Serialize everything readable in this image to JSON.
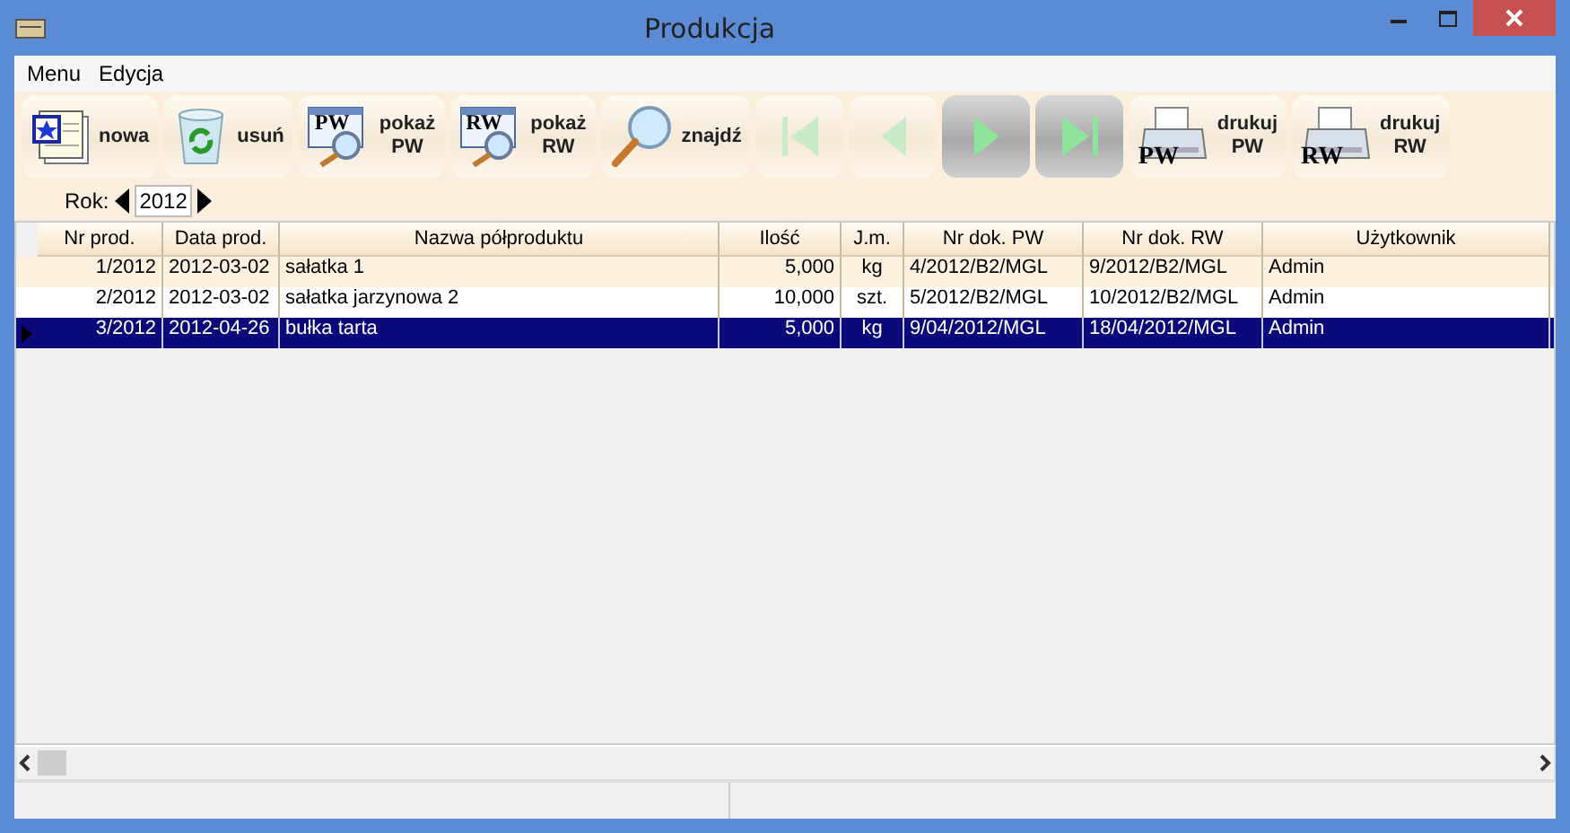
{
  "window": {
    "title": "Produkcja"
  },
  "menu": [
    "Menu",
    "Edycja"
  ],
  "toolbar": [
    {
      "kind": "new",
      "label": "nowa",
      "disabled": false
    },
    {
      "kind": "delete",
      "label": "usuń",
      "disabled": false
    },
    {
      "kind": "show",
      "label": "pokaż PW",
      "icon_text": "PW",
      "disabled": false
    },
    {
      "kind": "show",
      "label": "pokaż RW",
      "icon_text": "RW",
      "disabled": false
    },
    {
      "kind": "find",
      "label": "znajdź",
      "disabled": false
    },
    {
      "kind": "first",
      "disabled": true
    },
    {
      "kind": "prev",
      "disabled": true
    },
    {
      "kind": "next",
      "disabled": false
    },
    {
      "kind": "last",
      "disabled": false
    },
    {
      "kind": "print",
      "label": "drukuj PW",
      "icon_text": "PW",
      "disabled": false
    },
    {
      "kind": "print",
      "label": "drukuj RW",
      "icon_text": "RW",
      "disabled": false
    }
  ],
  "year": {
    "label": "Rok:",
    "value": "2012"
  },
  "table": {
    "columns": [
      "Nr prod.",
      "Data prod.",
      "Nazwa półproduktu",
      "Ilość",
      "J.m.",
      "Nr dok. PW",
      "Nr dok. RW",
      "Użytkownik"
    ],
    "rows": [
      {
        "cells": [
          "1/2012",
          "2012-03-02",
          "sałatka 1",
          "5,000",
          "kg",
          "4/2012/B2/MGL",
          "9/2012/B2/MGL",
          "Admin"
        ],
        "selected": false
      },
      {
        "cells": [
          "2/2012",
          "2012-03-02",
          "sałatka jarzynowa 2",
          "10,000",
          "szt.",
          "5/2012/B2/MGL",
          "10/2012/B2/MGL",
          "Admin"
        ],
        "selected": false
      },
      {
        "cells": [
          "3/2012",
          "2012-04-26",
          "bułka tarta",
          "5,000",
          "kg",
          "9/04/2012/MGL",
          "18/04/2012/MGL",
          "Admin"
        ],
        "selected": true
      }
    ]
  }
}
